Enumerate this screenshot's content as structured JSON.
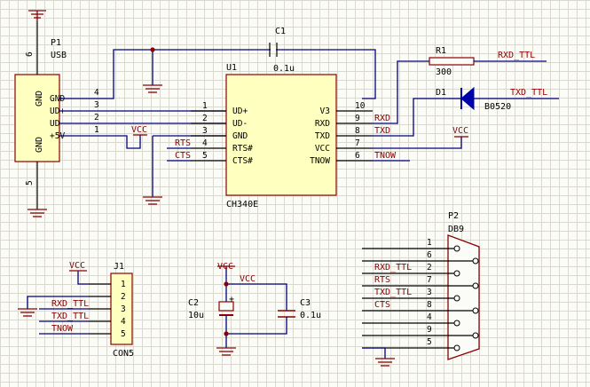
{
  "p1": {
    "designator": "P1",
    "name": "USB",
    "gnd1": "GND",
    "gnd2": "GND",
    "pins": [
      {
        "num": "4",
        "label": "GND"
      },
      {
        "num": "3",
        "label": "UD+"
      },
      {
        "num": "2",
        "label": "UD-"
      },
      {
        "num": "1",
        "label": "+5V"
      }
    ],
    "pin_top": "6",
    "pin_bottom": "5"
  },
  "u1": {
    "designator": "U1",
    "name": "CH340E",
    "left_pins": [
      {
        "num": "1",
        "label": "UD+"
      },
      {
        "num": "2",
        "label": "UD-"
      },
      {
        "num": "3",
        "label": "GND"
      },
      {
        "num": "4",
        "label": "RTS#"
      },
      {
        "num": "5",
        "label": "CTS#"
      }
    ],
    "right_pins": [
      {
        "num": "10",
        "label": "V3"
      },
      {
        "num": "9",
        "label": "RXD"
      },
      {
        "num": "8",
        "label": "TXD"
      },
      {
        "num": "7",
        "label": "VCC"
      },
      {
        "num": "6",
        "label": "TNOW"
      }
    ]
  },
  "c1": {
    "designator": "C1",
    "value": "0.1u"
  },
  "r1": {
    "designator": "R1",
    "value": "300"
  },
  "d1": {
    "designator": "D1",
    "value": "B0520"
  },
  "c2": {
    "designator": "C2",
    "value": "10u",
    "plus": "+"
  },
  "c3": {
    "designator": "C3",
    "value": "0.1u"
  },
  "j1": {
    "designator": "J1",
    "name": "CON5",
    "pins": [
      "1",
      "2",
      "3",
      "4",
      "5"
    ]
  },
  "p2": {
    "designator": "P2",
    "name": "DB9",
    "pins": [
      "1",
      "6",
      "2",
      "7",
      "3",
      "8",
      "4",
      "9",
      "5"
    ]
  },
  "nets": {
    "vcc": "VCC",
    "rxd_ttl": "RXD_TTL",
    "txd_ttl": "TXD_TTL",
    "rts": "RTS",
    "cts": "CTS",
    "rxd": "RXD",
    "txd": "TXD",
    "tnow": "TNOW"
  },
  "colors": {
    "wire": "#000080",
    "net_label": "#8b0000",
    "body_fill": "#ffffc0",
    "grid": "#d9d9d0"
  }
}
